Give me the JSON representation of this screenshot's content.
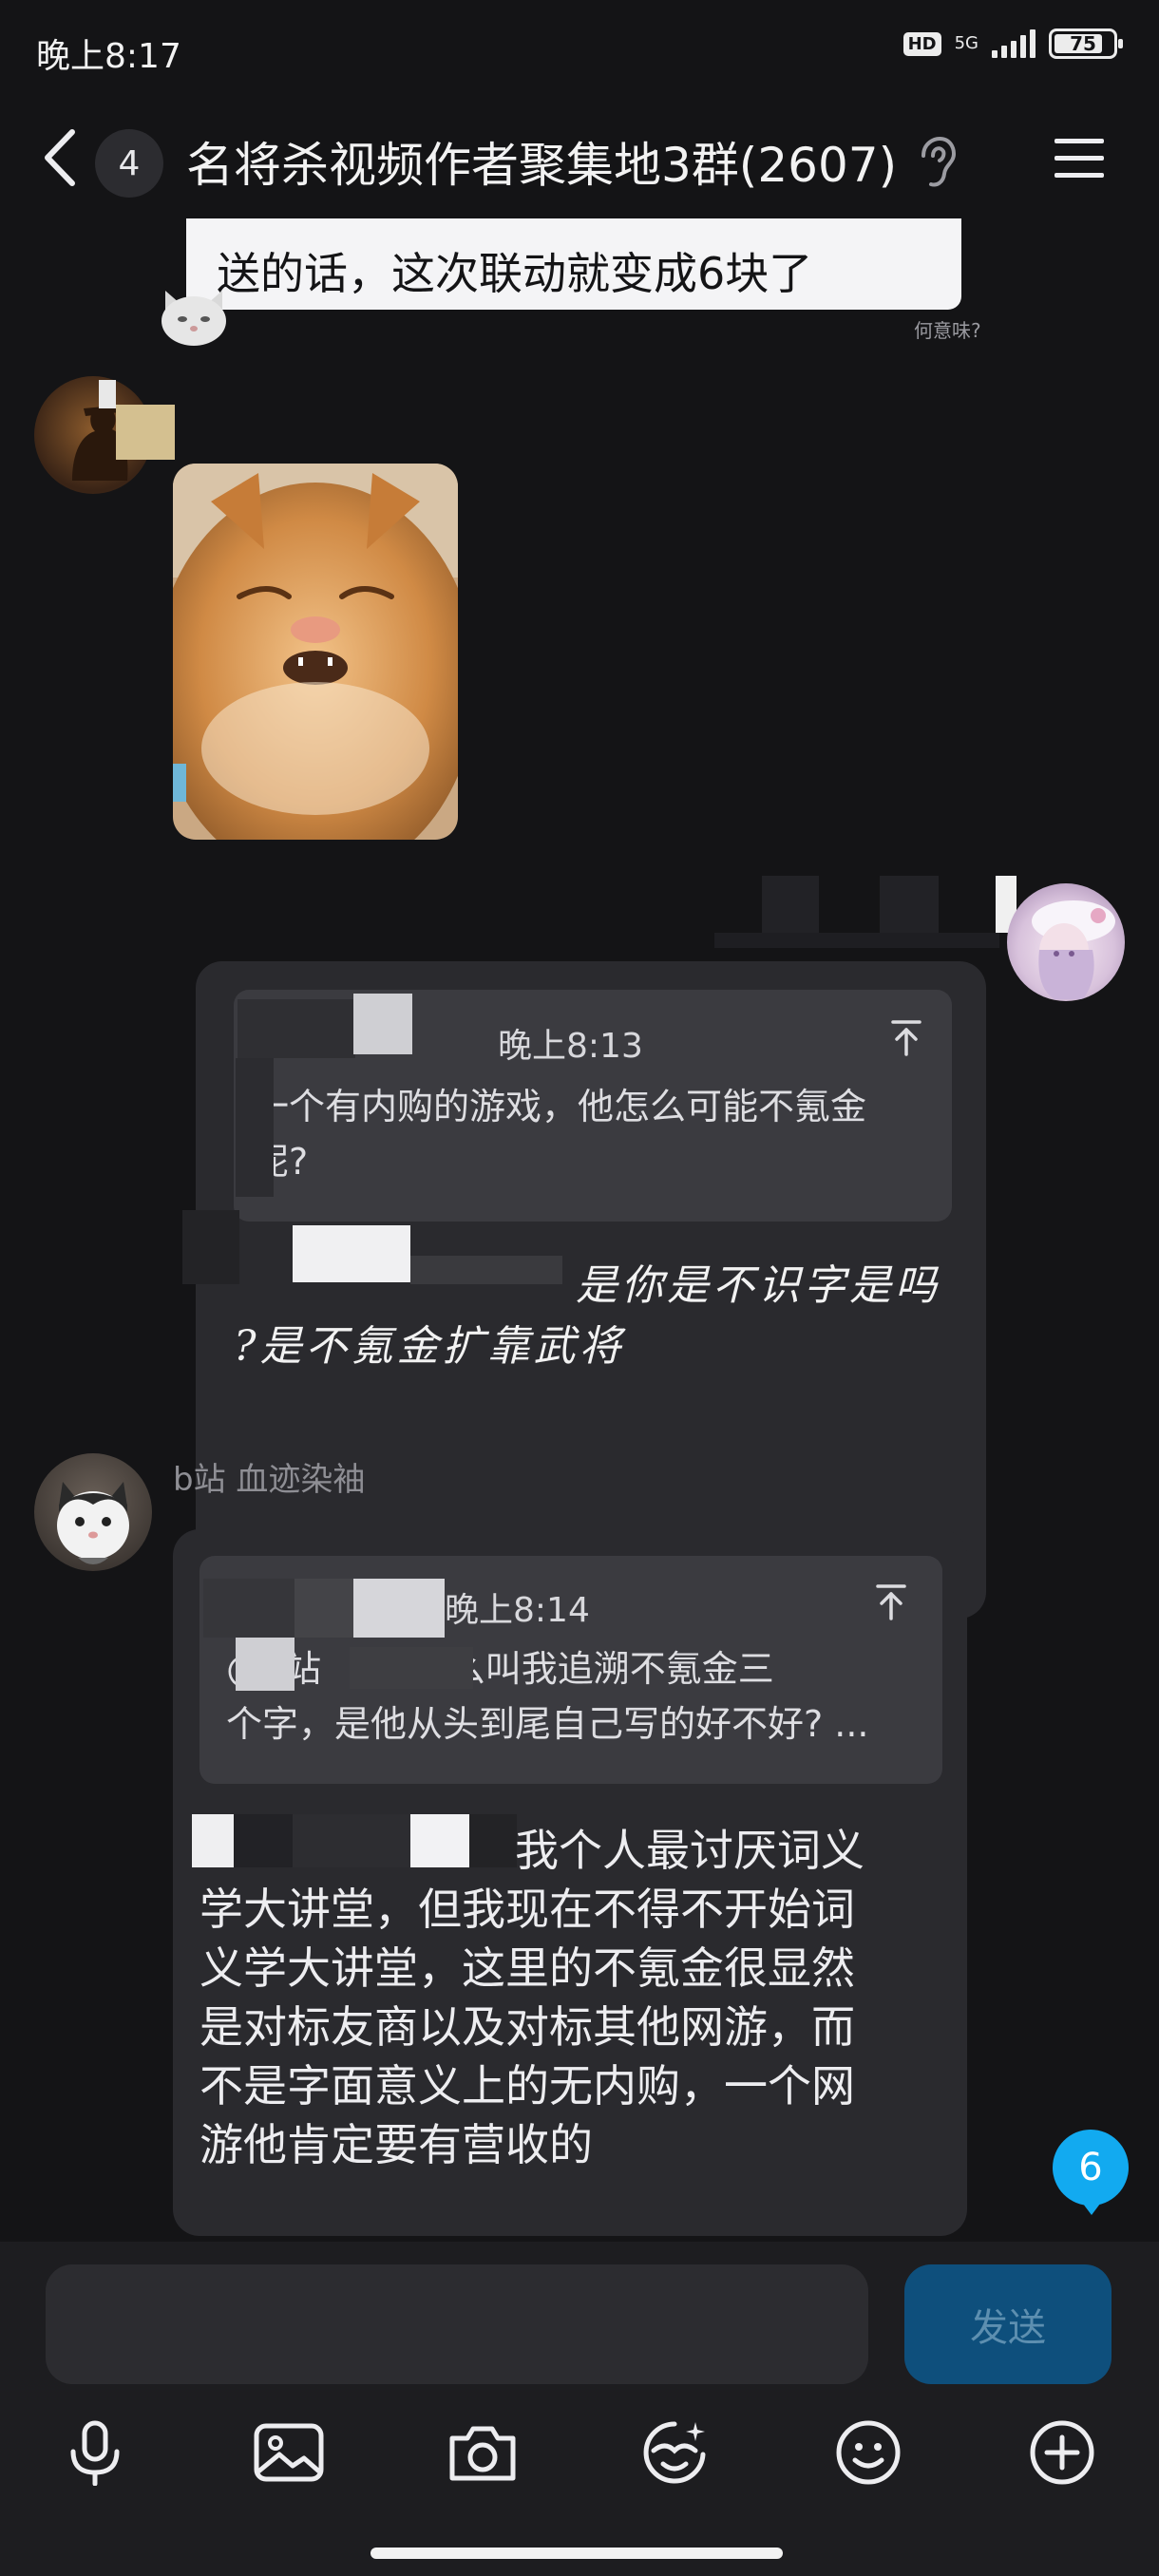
{
  "status_bar": {
    "time": "晚上8:17",
    "hd_label": "HD",
    "network_label": "5G",
    "battery_level": "75"
  },
  "header": {
    "unread_count": "4",
    "group_title": "名将杀视频作者聚集地3群(2607)",
    "back_icon": "chevron-left-icon",
    "ear_icon": "ear-icon",
    "menu_icon": "hamburger-menu-icon"
  },
  "messages": [
    {
      "type": "quote_card",
      "text": "送的话，这次联动就变成6块了",
      "caption": "何意味?"
    },
    {
      "type": "image",
      "content": "cat-photo"
    },
    {
      "type": "reply",
      "quote_time": "晚上8:13",
      "quote_text": "一个有内购的游戏，他怎么可能不氪金呢?",
      "text_line1": "是你是不识字是吗",
      "text_line2": "?是不氪金扩靠武将"
    },
    {
      "type": "reply",
      "sender": "b站 血迹染袖",
      "quote_time": "晚上8:14",
      "quote_line1": "@b站        什么叫我追溯不氪金三",
      "quote_line2": "个字，是他从头到尾自己写的好不好? ...",
      "text_lines": [
        "我个人最讨厌词义",
        "学大讲堂，但我现在不得不开始词",
        "义学大讲堂，这里的不氪金很显然",
        "是对标友商以及对标其他网游，而",
        "不是字面意义上的无内购，一个网",
        "游他肯定要有营收的"
      ]
    }
  ],
  "unread_float": "6",
  "composer": {
    "input_value": "",
    "send_label": "发送",
    "tools": [
      "microphone-icon",
      "image-icon",
      "camera-icon",
      "sticker-icon",
      "emoji-icon",
      "plus-icon"
    ]
  },
  "colors": {
    "background": "#141416",
    "bubble": "#2a2a2e",
    "quote": "#3b3b40",
    "accent": "#12aaf0",
    "send_button": "#0e4f7c"
  }
}
